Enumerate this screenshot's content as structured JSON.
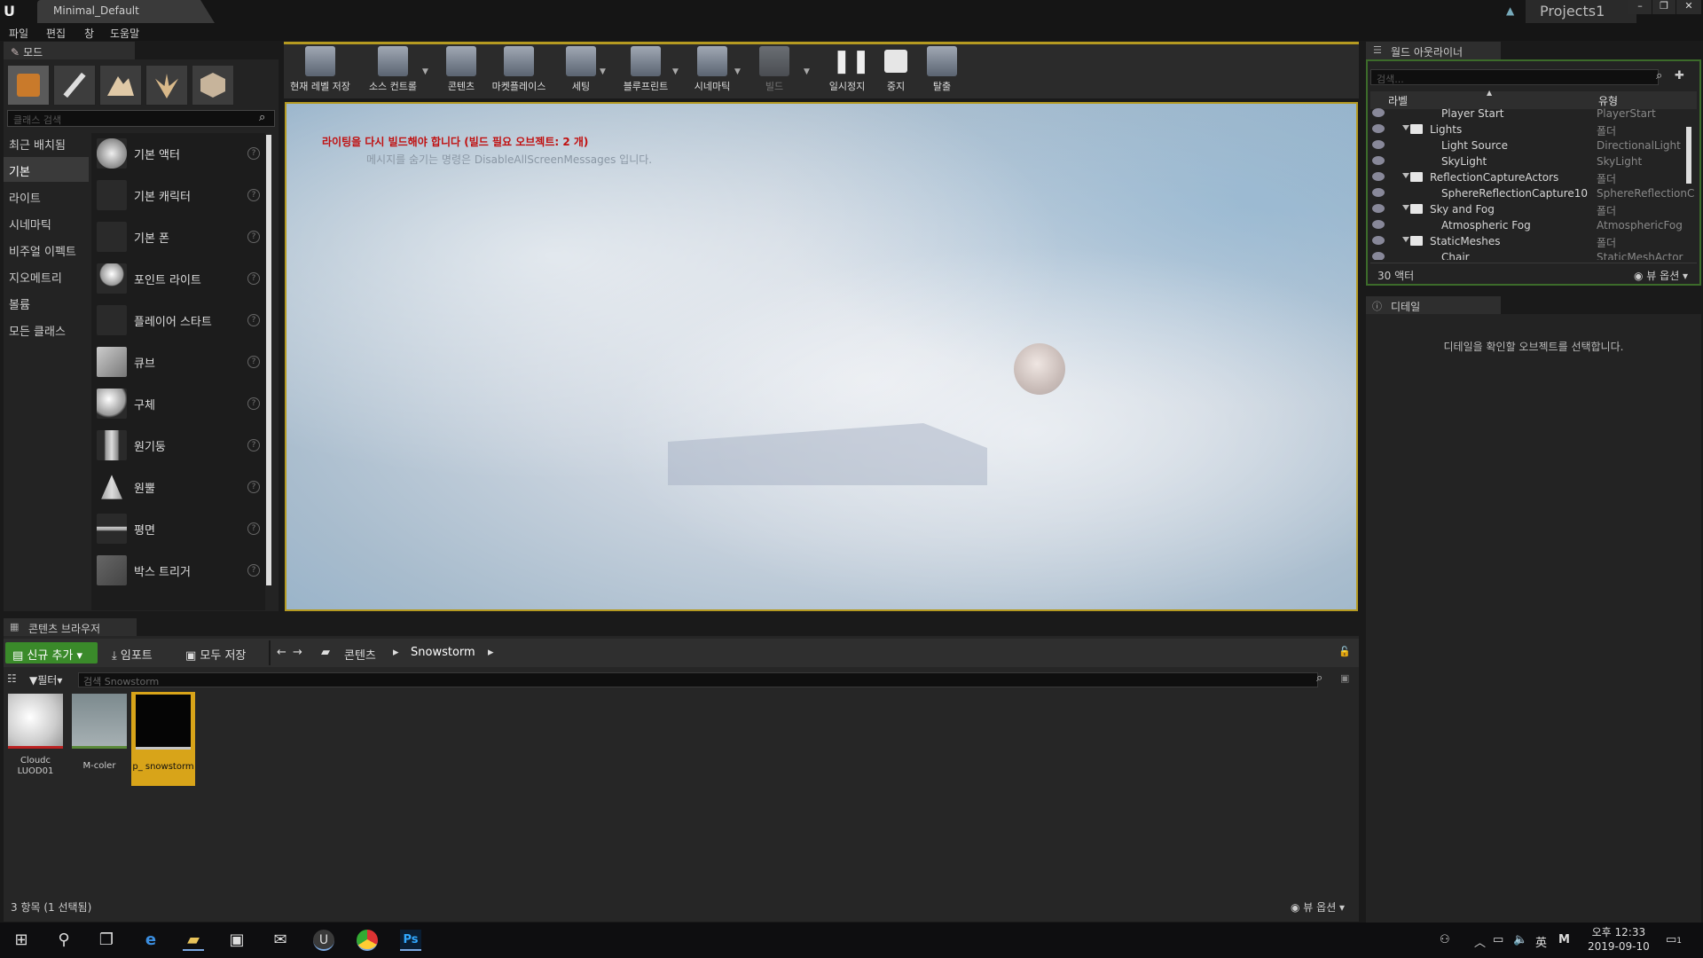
{
  "window": {
    "tab_title": "Minimal_Default",
    "project": "Projects1",
    "min": "–",
    "max": "❐",
    "close": "✕"
  },
  "menu": [
    "파일",
    "편집",
    "창",
    "도움말"
  ],
  "modes": {
    "tab_label": "모드",
    "search_placeholder": "클래스 검색",
    "categories": [
      "최근 배치됨",
      "기본",
      "라이트",
      "시네마틱",
      "비주얼 이펙트",
      "지오메트리",
      "볼륨",
      "모든 클래스"
    ],
    "items": [
      "기본 액터",
      "기본 캐릭터",
      "기본 폰",
      "포인트 라이트",
      "플레이어 스타트",
      "큐브",
      "구체",
      "원기둥",
      "원뿔",
      "평면",
      "박스 트리거"
    ],
    "help": "?"
  },
  "toolbar": {
    "buttons": [
      "현재 레벨 저장",
      "소스 컨트롤",
      "콘텐츠",
      "마켓플레이스",
      "세팅",
      "블루프린트",
      "시네마틱",
      "빌드",
      "일시정지",
      "중지",
      "탈출"
    ]
  },
  "viewport": {
    "warning": "라이팅을 다시 빌드해야 합니다 (빌드 필요 오브젝트: 2 개)",
    "hint": "메시지를 숨기는 명령은 DisableAllScreenMessages 입니다."
  },
  "outliner": {
    "tab_label": "월드 아웃라이너",
    "search_placeholder": "검색...",
    "col_label": "라벨",
    "col_type": "유형",
    "rows": [
      {
        "name": "Player Start",
        "type": "PlayerStart"
      },
      {
        "name": "Lights",
        "type": "폴더"
      },
      {
        "name": "Light Source",
        "type": "DirectionalLight"
      },
      {
        "name": "SkyLight",
        "type": "SkyLight"
      },
      {
        "name": "ReflectionCaptureActors",
        "type": "폴더"
      },
      {
        "name": "SphereReflectionCapture10",
        "type": "SphereReflectionC"
      },
      {
        "name": "Sky and Fog",
        "type": "폴더"
      },
      {
        "name": "Atmospheric Fog",
        "type": "AtmosphericFog"
      },
      {
        "name": "StaticMeshes",
        "type": "폴더"
      },
      {
        "name": "Chair",
        "type": "StaticMeshActor"
      }
    ],
    "count": "30 액터",
    "view_options": "뷰 옵션"
  },
  "details": {
    "tab_label": "디테일",
    "empty_msg": "디테일을 확인할 오브젝트를 선택합니다."
  },
  "content_browser": {
    "tab_label": "콘텐츠 브라우저",
    "add_new": "신규 추가",
    "import": "임포트",
    "save_all": "모두 저장",
    "path": [
      "콘텐츠",
      "Snowstorm"
    ],
    "filter": "필터",
    "search_placeholder": "검색 Snowstorm",
    "assets": [
      {
        "name": "Cloudc LUOD01"
      },
      {
        "name": "M-coler"
      },
      {
        "name": "p_ snowstorm"
      }
    ],
    "count": "3 항목 (1 선택됨)",
    "view_options": "뷰 옵션"
  },
  "taskbar": {
    "time": "오후 12:33",
    "date": "2019-09-10",
    "lang": "英",
    "ime": "M",
    "notif": "1"
  },
  "colors": {
    "accent": "#b59a21",
    "add_button": "#3a8a2a",
    "warning": "#c01010",
    "selected_asset": "#d8a419"
  }
}
